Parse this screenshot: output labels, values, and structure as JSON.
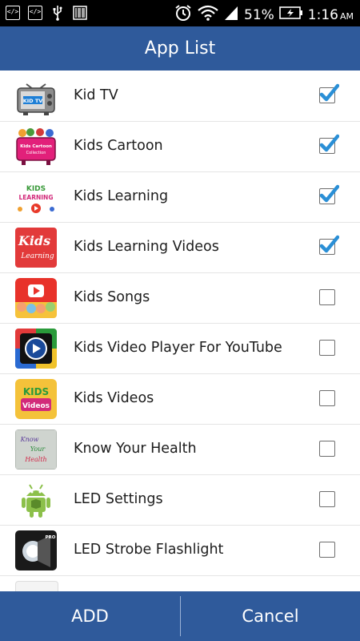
{
  "status_bar": {
    "battery": "51%",
    "time": "1:16",
    "ampm": "AM",
    "left_icons": [
      "code-icon",
      "code-icon",
      "usb-icon",
      "barcode-icon"
    ],
    "right_icons": [
      "alarm-icon",
      "wifi-icon",
      "signal-icon",
      "battery-charging-icon"
    ]
  },
  "title": "App List",
  "apps": [
    {
      "name": "Kid TV",
      "checked": true,
      "icon": "kid-tv-icon"
    },
    {
      "name": "Kids Cartoon",
      "checked": true,
      "icon": "kids-cartoon-icon"
    },
    {
      "name": "Kids Learning",
      "checked": true,
      "icon": "kids-learning-icon"
    },
    {
      "name": "Kids Learning Videos",
      "checked": true,
      "icon": "kids-learning-videos-icon"
    },
    {
      "name": "Kids Songs",
      "checked": false,
      "icon": "kids-songs-icon"
    },
    {
      "name": "Kids Video Player For YouTube",
      "checked": false,
      "icon": "kids-video-player-icon"
    },
    {
      "name": "Kids Videos",
      "checked": false,
      "icon": "kids-videos-icon"
    },
    {
      "name": "Know Your Health",
      "checked": false,
      "icon": "know-your-health-icon"
    },
    {
      "name": "LED Settings",
      "checked": false,
      "icon": "android-icon"
    },
    {
      "name": "LED Strobe Flashlight",
      "checked": false,
      "icon": "flashlight-icon"
    }
  ],
  "icon_text": {
    "kid_tv": "KID TV",
    "kids_cartoon_1": "Kids Cartoon",
    "kids_cartoon_2": "Collection",
    "kids_learning_1": "KIDS",
    "kids_learning_2": "LEARNING",
    "klv_1": "Kids",
    "klv_2": "Learning",
    "kv_1": "KIDS",
    "kv_2": "Videos",
    "kyh_1": "Know",
    "kyh_2": "Your",
    "kyh_3": "Health",
    "led_strobe": "PRO"
  },
  "buttons": {
    "add": "ADD",
    "cancel": "Cancel"
  },
  "colors": {
    "header": "#2f5a9b",
    "check": "#2a8fd6"
  }
}
